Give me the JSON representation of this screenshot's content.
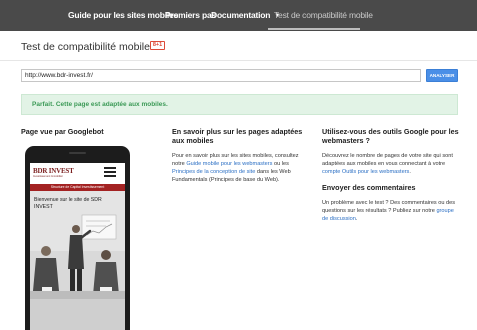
{
  "nav": {
    "items": [
      {
        "label": "Guide pour les sites mobiles"
      },
      {
        "label": "Premiers pas"
      },
      {
        "label": "Documentation"
      },
      {
        "label": "Test de compatibilité mobile"
      }
    ]
  },
  "page": {
    "title": "Test de compatibilité mobile",
    "gplus_label": "8+1"
  },
  "form": {
    "url_value": "http://www.bdr-invest.fr/",
    "analyze_label": "ANALYSER"
  },
  "result": {
    "message": "Parfait. Cette page est adaptée aux mobiles."
  },
  "columns": {
    "googlebot": {
      "heading": "Page vue par Googlebot"
    },
    "learn_more": {
      "heading": "En savoir plus sur les pages adaptées aux mobiles",
      "text_1": "Pour en savoir plus sur les sites mobiles, consultez notre",
      "link_1": "Guide mobile pour les webmasters",
      "text_2": "ou les",
      "link_2": "Principes de la conception de site",
      "text_3": "dans les Web Fundamentals (Principes de base du Web)."
    },
    "tools": {
      "heading": "Utilisez-vous des outils Google pour les webmasters ?",
      "text_1": "Découvrez le nombre de pages de votre site qui sont adaptées aux mobiles en vous connectant à votre",
      "link_1": "compte Outils pour les webmasters",
      "text_2": "."
    },
    "feedback": {
      "heading": "Envoyer des commentaires",
      "text_1": "Un problème avec le test ? Des commentaires ou des questions sur les résultats ? Publiez sur notre",
      "link_1": "groupe de discussion",
      "text_2": "."
    }
  },
  "phone_site": {
    "logo": "BDR INVEST",
    "logo_sub": "Investissement Immobilier",
    "banner": "Structure de Capital Investissement",
    "welcome": "Bienvenue sur le site de SDR INVEST"
  },
  "colors": {
    "topbar": "#4a4a4a",
    "success_bg": "#e2f3e6",
    "success_text": "#3c9a57",
    "link": "#2b6fc4",
    "analyze_button": "#4a8fe7",
    "site_banner": "#a32222"
  }
}
